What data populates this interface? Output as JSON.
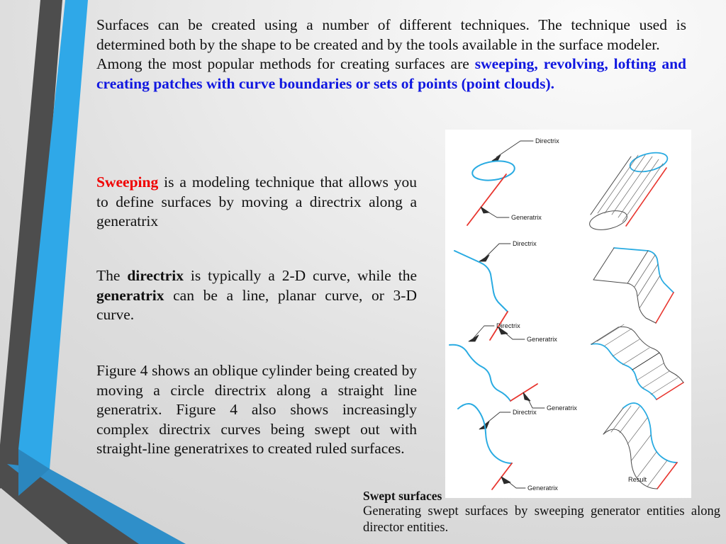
{
  "slide": {
    "background_color": "#e6e6e6",
    "accent_blue": "#2fa8e8",
    "accent_dark": "#4d4d4d"
  },
  "body": {
    "paragraph1": {
      "plain": "Surfaces can be created using a number of different techniques. The technique used is determined both by the shape to be created and by the tools available in the surface modeler.",
      "plain2_prefix": "Among the most popular methods for creating surfaces are ",
      "highlight": "sweeping, revolving, lofting and creating patches with curve boundaries or sets of points (point clouds).",
      "highlight_color": "#1017e0"
    },
    "paragraph2": {
      "lead": "Sweeping",
      "lead_color": "#f00000",
      "rest": " is a modeling technique that allows you to define surfaces by moving a directrix along a generatrix"
    },
    "paragraph3": {
      "part1": "The ",
      "bold1": "directrix",
      "part2": " is typically a 2-D curve, while the ",
      "bold2": "generatrix",
      "part3": " can be a line, planar curve, or 3-D curve."
    },
    "paragraph4": {
      "text": "Figure 4 shows an oblique cylinder being created by moving a circle directrix along a straight line generatrix. Figure 4 also shows increasingly complex directrix curves being swept out with straight-line generatrixes to created ruled surfaces."
    }
  },
  "figure": {
    "labels": {
      "directrix": "Directrix",
      "generatrix": "Generatrix",
      "result": "Result"
    },
    "rows": [
      {
        "id": "row-circle-cylinder",
        "directrix": "Directrix",
        "generatrix": "Generatrix"
      },
      {
        "id": "row-polyline-sheet",
        "directrix": "Directrix",
        "generatrix": "Generatrix"
      },
      {
        "id": "row-wavy-sheet",
        "directrix": "Directrix",
        "generatrix": "Generatrix"
      },
      {
        "id": "row-scurve-sheet",
        "directrix": "Directrix",
        "generatrix": "Generatrix",
        "result": "Result"
      }
    ],
    "colors": {
      "directrix_curve": "#29abe2",
      "generatrix_line": "#e8352e",
      "surface_line": "#404040",
      "leader_line": "#3a3a3a"
    }
  },
  "caption": {
    "title": "Swept surfaces",
    "text": "Generating swept surfaces by sweeping generator entities along director entities."
  }
}
